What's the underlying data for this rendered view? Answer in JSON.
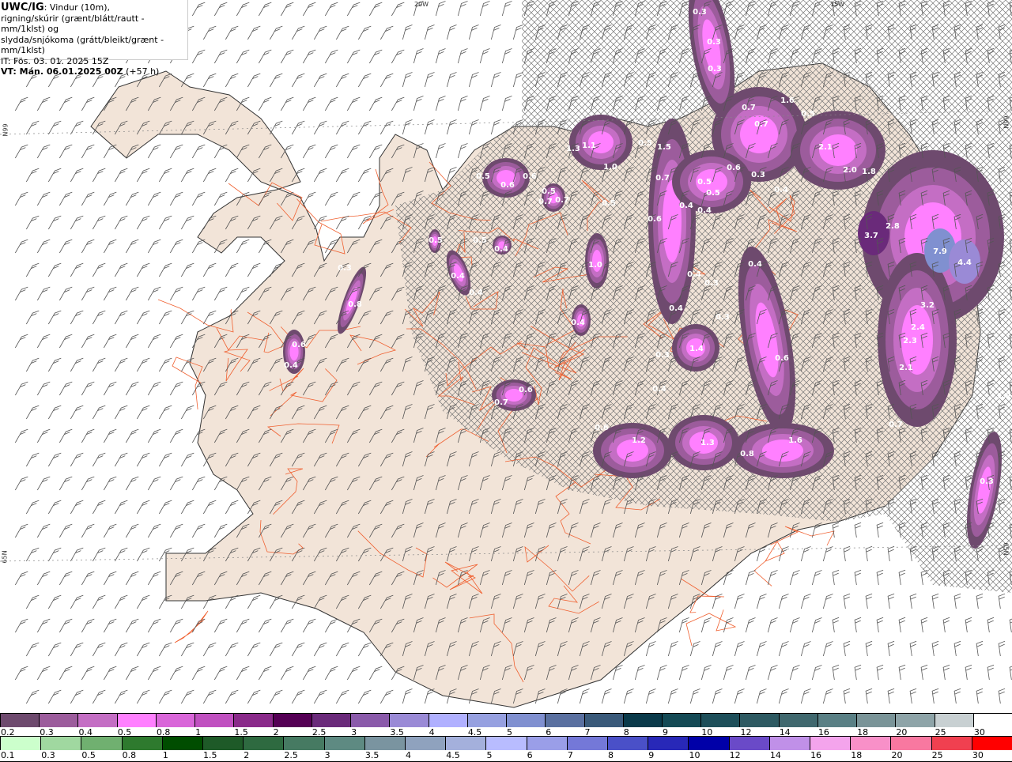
{
  "header": {
    "model": "UWC/IG",
    "line1": ": Vindur (10m),",
    "line2": "rigning/skúrir (grænt/blátt/rautt - mm/1klst) og",
    "line3": "slydda/snjókoma (grátt/bleikt/grænt - mm/1klst)",
    "it": "IT: Fös. 03. 01. 2025 15Z",
    "vt": "VT: Mán. 06.01.2025 00Z",
    "lead": "(+57 h)"
  },
  "axis_labels": {
    "lon_20w": "20W",
    "lon_15w": "15W",
    "lat_66n_left": "66N",
    "lat_66n_right": "66N",
    "lat_65n_left": "65N",
    "lat_65n_right": "65N"
  },
  "precip_values": [
    "0.3",
    "0.3",
    "0.3",
    "0.7",
    "1.6",
    "0.5",
    "0.7",
    "2.1",
    "2.0",
    "1.8",
    "1.3",
    "1.1",
    "0.5",
    "1.5",
    "0.7",
    "0.6",
    "0.3",
    "0.5",
    "0.5",
    "0.4",
    "1.0",
    "0.5",
    "0.6",
    "0.6",
    "0.5",
    "0.7",
    "0.7",
    "0.5",
    "0.6",
    "0.4",
    "0.4",
    "3.7",
    "2.8",
    "7.9",
    "4.4",
    "0.5",
    "0.5",
    "0.4",
    "1.0",
    "0.4",
    "0.4",
    "0.4",
    "0.4",
    "0.3",
    "0.3",
    "0.8",
    "0.4",
    "0.3",
    "3.2",
    "2.4",
    "2.3",
    "0.4",
    "0.6",
    "0.4",
    "1.4",
    "0.3",
    "0.6",
    "2.1",
    "0.4",
    "0.6",
    "0.7",
    "0.6",
    "0.7",
    "1.2",
    "1.3",
    "0.8",
    "1.6",
    "0.3",
    "1.2"
  ],
  "legend_snow": {
    "labels": [
      "0.2",
      "0.3",
      "0.4",
      "0.5",
      "0.8",
      "1",
      "1.5",
      "2",
      "2.5",
      "3",
      "3.5",
      "4",
      "4.5",
      "5",
      "6",
      "7",
      "8",
      "9",
      "10",
      "12",
      "14",
      "16",
      "18",
      "20",
      "25",
      "30"
    ],
    "colors": [
      "#6e4a6e",
      "#9c5c9c",
      "#c46ec4",
      "#ff80ff",
      "#d966d9",
      "#c050c0",
      "#8a2a8a",
      "#550055",
      "#6a2a7a",
      "#8a5aaa",
      "#9a8ad6",
      "#b0b0ff",
      "#96a0e0",
      "#8090d0",
      "#5a70a0",
      "#3a5a7a",
      "#0a3a4a",
      "#144a55",
      "#1e4f5a",
      "#2e5a62",
      "#40686e",
      "#5a8085",
      "#7a9498",
      "#8ea4a8",
      "#c8d0d2",
      "#ffffff"
    ]
  },
  "legend_rain": {
    "labels": [
      "0.1",
      "0.3",
      "0.5",
      "0.8",
      "1",
      "1.5",
      "2",
      "2.5",
      "3",
      "3.5",
      "4",
      "4.5",
      "5",
      "6",
      "7",
      "8",
      "9",
      "10",
      "12",
      "14",
      "16",
      "18",
      "20",
      "25",
      "30"
    ],
    "colors": [
      "#ccffcc",
      "#a0d8a0",
      "#70b070",
      "#2e7a2e",
      "#004d00",
      "#1e5a28",
      "#2e6a40",
      "#467a62",
      "#5e8a82",
      "#7a94a0",
      "#8fa2be",
      "#a4b0dc",
      "#b8bcff",
      "#9a9ee8",
      "#7478d8",
      "#4a50c8",
      "#2828b8",
      "#0000a8",
      "#6a4ac8",
      "#c090e8",
      "#f4a4ec",
      "#f890c8",
      "#f878a0",
      "#f04050",
      "#ff0000"
    ]
  },
  "colors": {
    "land": "#f2e4d8",
    "sea": "#ffffff",
    "roads": "#f06030",
    "coast": "#333333"
  }
}
